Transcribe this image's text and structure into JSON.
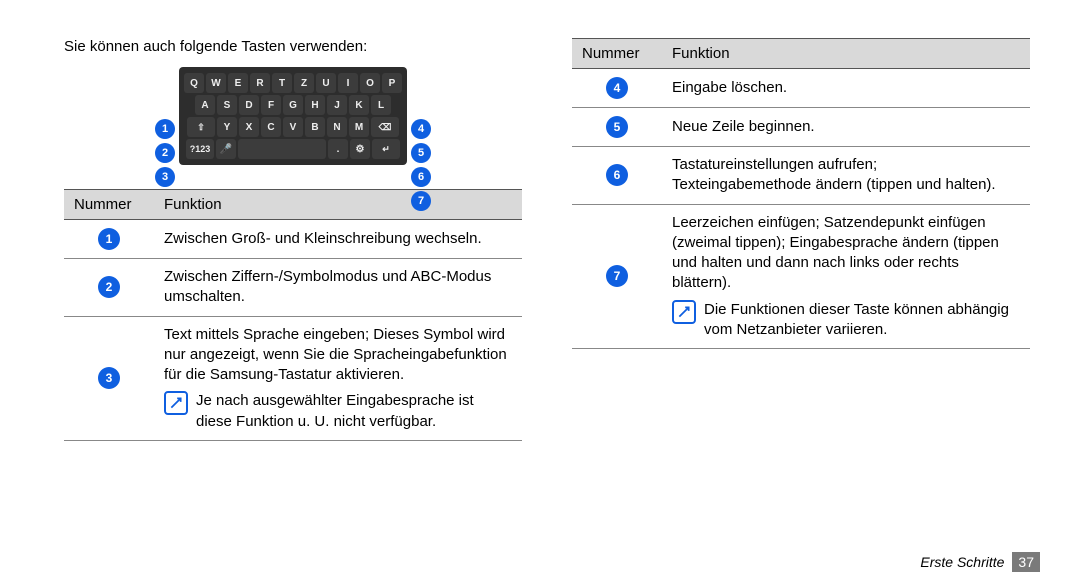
{
  "intro": "Sie können auch folgende Tasten verwenden:",
  "keyboard": {
    "row1": [
      "Q",
      "W",
      "E",
      "R",
      "T",
      "Z",
      "U",
      "I",
      "O",
      "P"
    ],
    "row2": [
      "A",
      "S",
      "D",
      "F",
      "G",
      "H",
      "J",
      "K",
      "L"
    ],
    "row3_shift": "⇧",
    "row3": [
      "Y",
      "X",
      "C",
      "V",
      "B",
      "N",
      "M"
    ],
    "row3_del": "⌫",
    "row4_mode": "?123",
    "row4_mic": "🎤",
    "row4_space": "",
    "row4_dot": ".",
    "row4_gear": "⚙",
    "row4_enter": "↵"
  },
  "callouts": {
    "1": "1",
    "2": "2",
    "3": "3",
    "4": "4",
    "5": "5",
    "6": "6",
    "7": "7"
  },
  "table_left": {
    "head_num": "Nummer",
    "head_func": "Funktion",
    "r1": "Zwischen Groß- und Kleinschreibung wechseln.",
    "r2": "Zwischen Ziffern-/Symbolmodus und ABC-Modus umschalten.",
    "r3_main": "Text mittels Sprache eingeben; Dieses Symbol wird nur angezeigt, wenn Sie die Spracheingabefunktion für die Samsung-Tastatur aktivieren.",
    "r3_note": "Je nach ausgewählter Eingabesprache ist diese Funktion u. U. nicht verfügbar."
  },
  "table_right": {
    "head_num": "Nummer",
    "head_func": "Funktion",
    "r4": "Eingabe löschen.",
    "r5": "Neue Zeile beginnen.",
    "r6": "Tastatureinstellungen aufrufen; Texteingabemethode ändern (tippen und halten).",
    "r7_main": "Leerzeichen einfügen; Satzendepunkt einfügen (zweimal tippen); Eingabesprache ändern (tippen und halten und dann nach links oder rechts blättern).",
    "r7_note": "Die Funktionen dieser Taste können abhängig vom Netzanbieter variieren."
  },
  "footer": {
    "section": "Erste Schritte",
    "page": "37"
  }
}
